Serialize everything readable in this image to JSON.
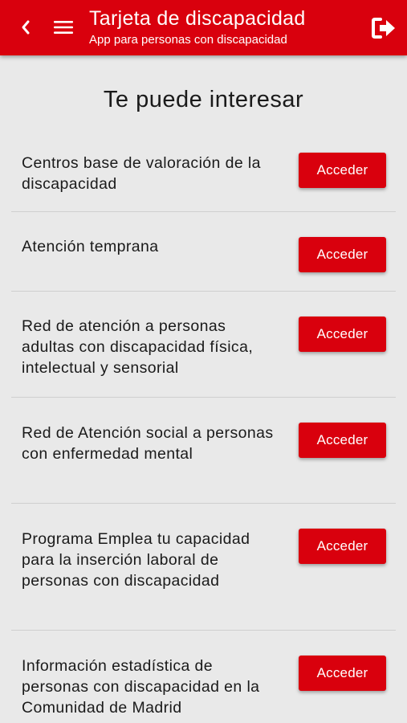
{
  "colors": {
    "brand": "#d9000d",
    "background": "#e9e9e9",
    "text": "#1a1a1a",
    "on_brand": "#ffffff"
  },
  "header": {
    "title": "Tarjeta de discapacidad",
    "subtitle": "App para personas con discapacidad",
    "icons": [
      "chevron-left-icon",
      "hamburger-menu-icon",
      "logout-icon"
    ]
  },
  "section": {
    "title": "Te puede interesar"
  },
  "items": [
    {
      "label": "Centros base de valoración de la discapacidad",
      "button": "Acceder"
    },
    {
      "label": "Atención temprana",
      "button": "Acceder"
    },
    {
      "label": "Red de atención a personas adultas con discapacidad física, intelectual y sensorial",
      "button": "Acceder"
    },
    {
      "label": "Red de Atención social a personas con enfermedad mental",
      "button": "Acceder"
    },
    {
      "label": "Programa Emplea tu capacidad para la inserción laboral de personas con discapacidad",
      "button": "Acceder"
    },
    {
      "label": "Información estadística de personas con discapacidad en la Comunidad de Madrid",
      "button": "Acceder"
    }
  ]
}
